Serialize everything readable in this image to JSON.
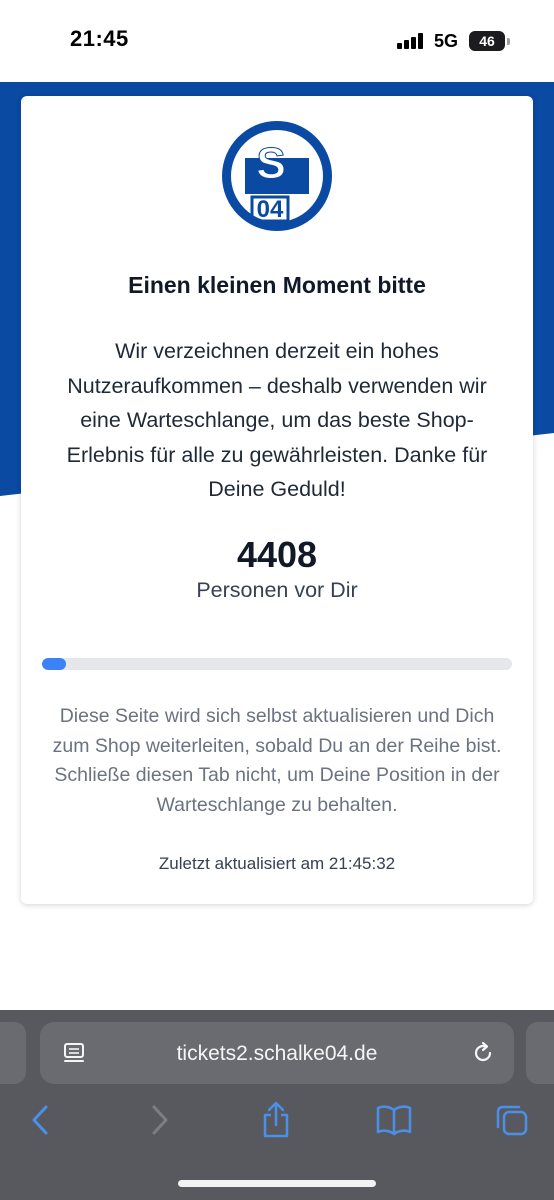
{
  "status_bar": {
    "time": "21:45",
    "network": "5G",
    "battery": "46"
  },
  "card": {
    "title": "Einen kleinen Moment bitte",
    "message": "Wir verzeichnen derzeit ein hohes Nutzeraufkommen – deshalb verwenden wir eine Warteschlange, um das beste Shop-Erlebnis für alle zu gewährleisten. Danke für Deine Geduld!",
    "queue_count": "4408",
    "queue_label": "Personen vor Dir",
    "progress_percent": 5,
    "info": "Diese Seite wird sich selbst aktualisieren und Dich zum Shop weiterleiten, sobald Du an der Reihe bist. Schließe diesen Tab nicht, um Deine Position in der Warteschlange zu behalten.",
    "last_updated": "Zuletzt aktualisiert am 21:45:32"
  },
  "logo": {
    "text": "S 04",
    "color": "#0a4aa3"
  },
  "browser": {
    "url": "tickets2.schalke04.de",
    "icons": [
      "page-menu-icon",
      "reload-icon",
      "back-icon",
      "forward-icon",
      "share-icon",
      "bookmarks-icon",
      "tabs-icon"
    ]
  },
  "colors": {
    "brand_blue": "#0a4aa3",
    "progress_blue": "#3b82f6",
    "safari_bar": "#58595e",
    "ios_blue": "#4a8fe8"
  }
}
